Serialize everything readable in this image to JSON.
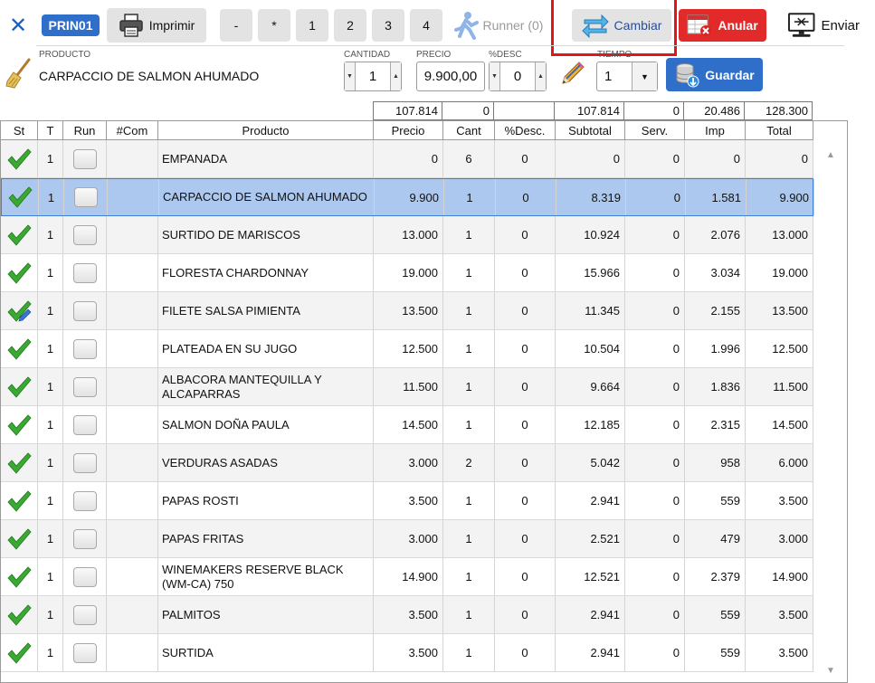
{
  "toolbar": {
    "close_glyph": "✕",
    "printer_code": "PRIN01",
    "print_label": "Imprimir",
    "keys": [
      "-",
      "*",
      "1",
      "2",
      "3",
      "4"
    ],
    "runner_label": "Runner (0)",
    "change_label": "Cambiar",
    "void_label": "Anular",
    "send_label": "Enviar"
  },
  "editor": {
    "product_label": "PRODUCTO",
    "product_value": "CARPACCIO DE SALMON AHUMADO",
    "qty_label": "CANTIDAD",
    "qty_value": "1",
    "price_label": "PRECIO",
    "price_value": "9.900,00",
    "disc_label": "%DESC",
    "disc_value": "0",
    "time_label": "TIEMPO",
    "time_value": "1",
    "save_label": "Guardar"
  },
  "totals": {
    "precio": "107.814",
    "desc": "0",
    "subtotal": "107.814",
    "serv": "0",
    "imp": "20.486",
    "total": "128.300"
  },
  "table": {
    "headers": [
      "St",
      "T",
      "Run",
      "#Com",
      "Producto",
      "Precio",
      "Cant",
      "%Desc.",
      "Subtotal",
      "Serv.",
      "Imp",
      "Total"
    ],
    "selected_index": 1,
    "rows": [
      {
        "status": "ok",
        "t": "1",
        "producto": "EMPANADA",
        "precio": "0",
        "cant": "6",
        "desc": "0",
        "subtotal": "0",
        "serv": "0",
        "imp": "0",
        "total": "0"
      },
      {
        "status": "ok",
        "t": "1",
        "producto": "CARPACCIO DE SALMON AHUMADO",
        "precio": "9.900",
        "cant": "1",
        "desc": "0",
        "subtotal": "8.319",
        "serv": "0",
        "imp": "1.581",
        "total": "9.900"
      },
      {
        "status": "ok",
        "t": "1",
        "producto": "SURTIDO DE MARISCOS",
        "precio": "13.000",
        "cant": "1",
        "desc": "0",
        "subtotal": "10.924",
        "serv": "0",
        "imp": "2.076",
        "total": "13.000"
      },
      {
        "status": "ok",
        "t": "1",
        "producto": "FLORESTA CHARDONNAY",
        "precio": "19.000",
        "cant": "1",
        "desc": "0",
        "subtotal": "15.966",
        "serv": "0",
        "imp": "3.034",
        "total": "19.000"
      },
      {
        "status": "ok-edited",
        "t": "1",
        "producto": "FILETE SALSA PIMIENTA",
        "precio": "13.500",
        "cant": "1",
        "desc": "0",
        "subtotal": "11.345",
        "serv": "0",
        "imp": "2.155",
        "total": "13.500"
      },
      {
        "status": "ok",
        "t": "1",
        "producto": "PLATEADA EN SU JUGO",
        "precio": "12.500",
        "cant": "1",
        "desc": "0",
        "subtotal": "10.504",
        "serv": "0",
        "imp": "1.996",
        "total": "12.500"
      },
      {
        "status": "ok",
        "t": "1",
        "producto": "ALBACORA MANTEQUILLA Y ALCAPARRAS",
        "precio": "11.500",
        "cant": "1",
        "desc": "0",
        "subtotal": "9.664",
        "serv": "0",
        "imp": "1.836",
        "total": "11.500"
      },
      {
        "status": "ok",
        "t": "1",
        "producto": "SALMON DOÑA PAULA",
        "precio": "14.500",
        "cant": "1",
        "desc": "0",
        "subtotal": "12.185",
        "serv": "0",
        "imp": "2.315",
        "total": "14.500"
      },
      {
        "status": "ok",
        "t": "1",
        "producto": "VERDURAS ASADAS",
        "precio": "3.000",
        "cant": "2",
        "desc": "0",
        "subtotal": "5.042",
        "serv": "0",
        "imp": "958",
        "total": "6.000"
      },
      {
        "status": "ok",
        "t": "1",
        "producto": "PAPAS ROSTI",
        "precio": "3.500",
        "cant": "1",
        "desc": "0",
        "subtotal": "2.941",
        "serv": "0",
        "imp": "559",
        "total": "3.500"
      },
      {
        "status": "ok",
        "t": "1",
        "producto": "PAPAS FRITAS",
        "precio": "3.000",
        "cant": "1",
        "desc": "0",
        "subtotal": "2.521",
        "serv": "0",
        "imp": "479",
        "total": "3.000"
      },
      {
        "status": "ok",
        "t": "1",
        "producto": "WINEMAKERS RESERVE BLACK (WM-CA) 750",
        "precio": "14.900",
        "cant": "1",
        "desc": "0",
        "subtotal": "12.521",
        "serv": "0",
        "imp": "2.379",
        "total": "14.900"
      },
      {
        "status": "ok",
        "t": "1",
        "producto": "PALMITOS",
        "precio": "3.500",
        "cant": "1",
        "desc": "0",
        "subtotal": "2.941",
        "serv": "0",
        "imp": "559",
        "total": "3.500"
      },
      {
        "status": "ok",
        "t": "1",
        "producto": "SURTIDA",
        "precio": "3.500",
        "cant": "1",
        "desc": "0",
        "subtotal": "2.941",
        "serv": "0",
        "imp": "559",
        "total": "3.500"
      }
    ]
  },
  "colors": {
    "accent": "#2f6fc9",
    "void": "#e32a2a",
    "selected_row": "#adc8ef",
    "check": "#3aa832",
    "highlight": "#e4141b"
  }
}
